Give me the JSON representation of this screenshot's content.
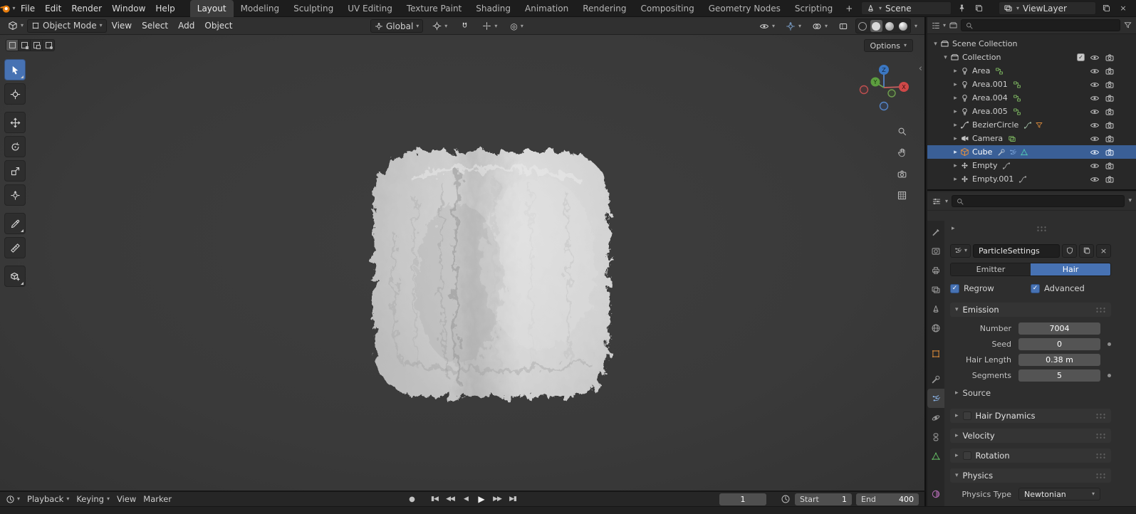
{
  "icons": {
    "chevron_down": "▾",
    "chevron_right": "▸",
    "chevron_left": "‹",
    "check": "✓",
    "close": "×",
    "record_dot": "●",
    "jump_start": "▮◀",
    "prev_keyframe": "◀◀",
    "play_reverse": "◀",
    "play": "▶",
    "next_keyframe": "▶▶",
    "jump_end": "▶▮",
    "proportional": "◎"
  },
  "topbar": {
    "menus": [
      "File",
      "Edit",
      "Render",
      "Window",
      "Help"
    ],
    "workspaces": [
      "Layout",
      "Modeling",
      "Sculpting",
      "UV Editing",
      "Texture Paint",
      "Shading",
      "Animation",
      "Rendering",
      "Compositing",
      "Geometry Nodes",
      "Scripting"
    ],
    "add_workspace": "+",
    "scene_label": "Scene",
    "viewlayer_label": "ViewLayer"
  },
  "viewport": {
    "header": {
      "mode": "Object Mode",
      "menus": [
        "View",
        "Select",
        "Add",
        "Object"
      ],
      "orientation": "Global"
    },
    "options_label": "Options",
    "gizmo": {
      "z": "Z",
      "y": "Y",
      "x": "X"
    }
  },
  "outliner": {
    "scene_collection": "Scene Collection",
    "collection": "Collection",
    "items": [
      {
        "label": "Area"
      },
      {
        "label": "Area.001"
      },
      {
        "label": "Area.004"
      },
      {
        "label": "Area.005"
      },
      {
        "label": "BezierCircle"
      },
      {
        "label": "Camera"
      },
      {
        "label": "Cube"
      },
      {
        "label": "Empty"
      },
      {
        "label": "Empty.001"
      }
    ]
  },
  "properties": {
    "name_field": "ParticleSettings",
    "emitter_label": "Emitter",
    "hair_label": "Hair",
    "regrow_label": "Regrow",
    "advanced_label": "Advanced",
    "emission_title": "Emission",
    "rows": [
      {
        "label": "Number",
        "value": "7004"
      },
      {
        "label": "Seed",
        "value": "0"
      },
      {
        "label": "Hair Length",
        "value": "0.38 m"
      },
      {
        "label": "Segments",
        "value": "5"
      }
    ],
    "source_label": "Source",
    "hair_dynamics_label": "Hair Dynamics",
    "velocity_label": "Velocity",
    "rotation_label": "Rotation",
    "physics_title": "Physics",
    "physics_type_label": "Physics Type",
    "physics_type_value": "Newtonian"
  },
  "timeline": {
    "playback": "Playback",
    "keying": "Keying",
    "view": "View",
    "marker": "Marker",
    "current_frame": "1",
    "start_label": "Start",
    "start_value": "1",
    "end_label": "End",
    "end_value": "400"
  },
  "colors": {
    "accent": "#4772b3",
    "selection": "#3a5f96",
    "object_orange": "#e0862c",
    "axis_x": "#cf4848",
    "axis_y": "#5c9e3f",
    "axis_z": "#3b77c2"
  }
}
